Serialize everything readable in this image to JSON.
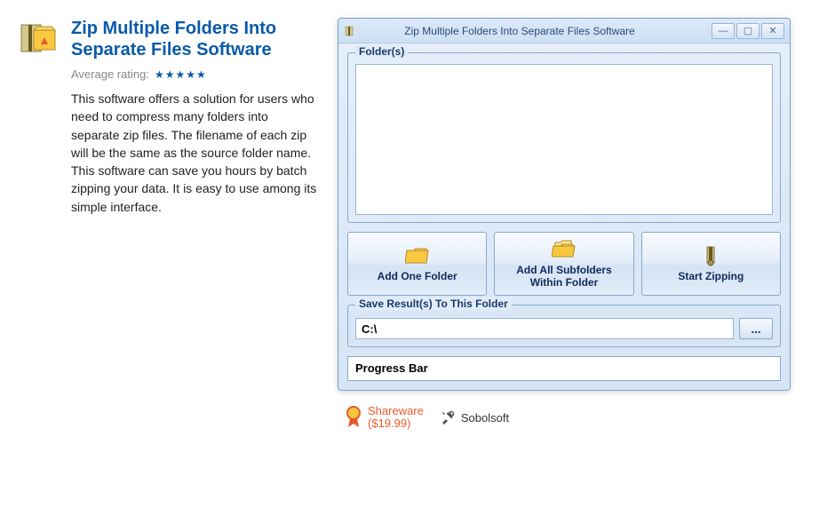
{
  "product": {
    "title": "Zip Multiple Folders Into Separate Files Software",
    "rating_label": "Average rating:",
    "stars": 5,
    "description": "This software offers a solution for users who need to compress many folders into separate zip files. The filename of each zip will be the same as the source folder name. This software can save you hours by batch zipping your data. It is easy to use among its simple interface."
  },
  "window": {
    "title": "Zip Multiple Folders Into Separate Files Software",
    "folders_legend": "Folder(s)",
    "buttons": {
      "add_one": "Add One Folder",
      "add_all": "Add All Subfolders Within Folder",
      "start": "Start Zipping"
    },
    "save_legend": "Save Result(s) To This Folder",
    "save_path": "C:\\",
    "browse_label": "...",
    "progress_label": "Progress Bar"
  },
  "meta": {
    "license": "Shareware",
    "price": "($19.99)",
    "vendor": "Sobolsoft"
  }
}
